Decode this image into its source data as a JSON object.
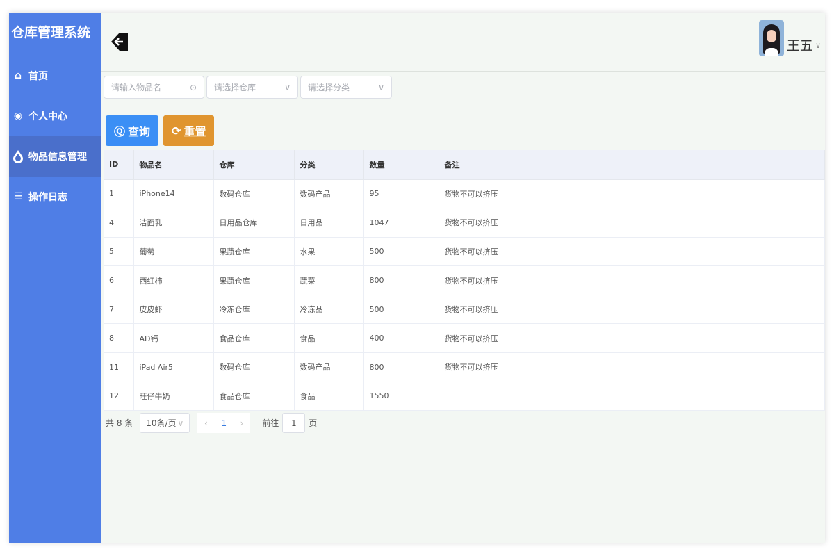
{
  "sidebar": {
    "title": "仓库管理系统",
    "items": [
      {
        "label": "首页",
        "icon": "home-icon"
      },
      {
        "label": "个人中心",
        "icon": "user-icon"
      },
      {
        "label": "物品信息管理",
        "icon": "drop-icon",
        "active": true
      },
      {
        "label": "操作日志",
        "icon": "document-icon"
      }
    ]
  },
  "header": {
    "user_name": "王五"
  },
  "filters": {
    "name_placeholder": "请输入物品名",
    "warehouse_placeholder": "请选择仓库",
    "category_placeholder": "请选择分类"
  },
  "buttons": {
    "query": "查询",
    "reset": "重置"
  },
  "colors": {
    "sidebar": "#4f7ee6",
    "query": "#3b8ff5",
    "reset": "#e0952f"
  },
  "table": {
    "columns": [
      "ID",
      "物品名",
      "仓库",
      "分类",
      "数量",
      "备注"
    ],
    "rows": [
      [
        "1",
        "iPhone14",
        "数码仓库",
        "数码产品",
        "95",
        "货物不可以挤压"
      ],
      [
        "4",
        "洁面乳",
        "日用品仓库",
        "日用品",
        "1047",
        "货物不可以挤压"
      ],
      [
        "5",
        "葡萄",
        "果蔬仓库",
        "水果",
        "500",
        "货物不可以挤压"
      ],
      [
        "6",
        "西红柿",
        "果蔬仓库",
        "蔬菜",
        "800",
        "货物不可以挤压"
      ],
      [
        "7",
        "皮皮虾",
        "冷冻仓库",
        "冷冻品",
        "500",
        "货物不可以挤压"
      ],
      [
        "8",
        "AD钙",
        "食品仓库",
        "食品",
        "400",
        "货物不可以挤压"
      ],
      [
        "11",
        "iPad Air5",
        "数码仓库",
        "数码产品",
        "800",
        "货物不可以挤压"
      ],
      [
        "12",
        "旺仔牛奶",
        "食品仓库",
        "食品",
        "1550",
        ""
      ]
    ]
  },
  "pagination": {
    "total": "共 8 条",
    "page_size": "10条/页",
    "current": "1",
    "goto_label": "前往",
    "goto_value": "1",
    "page_suffix": "页"
  }
}
